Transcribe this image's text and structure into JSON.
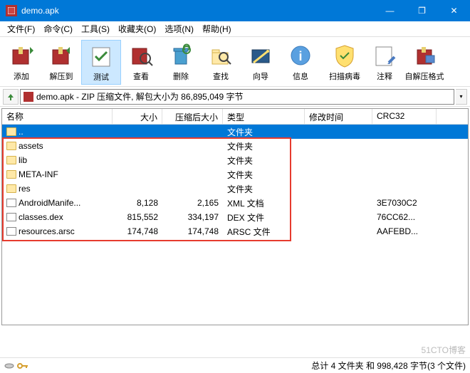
{
  "window": {
    "title": "demo.apk",
    "min": "—",
    "restore": "❐",
    "close": "✕"
  },
  "menu": {
    "file": "文件(F)",
    "cmd": "命令(C)",
    "tool": "工具(S)",
    "fav": "收藏夹(O)",
    "opt": "选项(N)",
    "help": "帮助(H)"
  },
  "toolbar": {
    "add": "添加",
    "extract": "解压到",
    "test": "测试",
    "view": "查看",
    "delete": "删除",
    "find": "查找",
    "wizard": "向导",
    "info": "信息",
    "virus": "扫描病毒",
    "comment": "注释",
    "sfx": "自解压格式"
  },
  "path": {
    "text": "demo.apk - ZIP 压缩文件, 解包大小为 86,895,049 字节"
  },
  "columns": {
    "name": "名称",
    "size": "大小",
    "packed": "压缩后大小",
    "type": "类型",
    "modified": "修改时间",
    "crc": "CRC32"
  },
  "rows": [
    {
      "name": "..",
      "size": "",
      "packed": "",
      "type": "文件夹",
      "modified": "",
      "crc": "",
      "icon": "fold",
      "sel": true
    },
    {
      "name": "assets",
      "size": "",
      "packed": "",
      "type": "文件夹",
      "modified": "",
      "crc": "",
      "icon": "fold"
    },
    {
      "name": "lib",
      "size": "",
      "packed": "",
      "type": "文件夹",
      "modified": "",
      "crc": "",
      "icon": "fold"
    },
    {
      "name": "META-INF",
      "size": "",
      "packed": "",
      "type": "文件夹",
      "modified": "",
      "crc": "",
      "icon": "fold"
    },
    {
      "name": "res",
      "size": "",
      "packed": "",
      "type": "文件夹",
      "modified": "",
      "crc": "",
      "icon": "fold"
    },
    {
      "name": "AndroidManife...",
      "size": "8,128",
      "packed": "2,165",
      "type": "XML 文档",
      "modified": "",
      "crc": "3E7030C2",
      "icon": "file"
    },
    {
      "name": "classes.dex",
      "size": "815,552",
      "packed": "334,197",
      "type": "DEX 文件",
      "modified": "",
      "crc": "76CC62...",
      "icon": "file"
    },
    {
      "name": "resources.arsc",
      "size": "174,748",
      "packed": "174,748",
      "type": "ARSC 文件",
      "modified": "",
      "crc": "AAFEBD...",
      "icon": "file"
    }
  ],
  "status": {
    "text": "总计 4 文件夹 和 998,428 字节(3 个文件)"
  },
  "watermark": "51CTO博客"
}
